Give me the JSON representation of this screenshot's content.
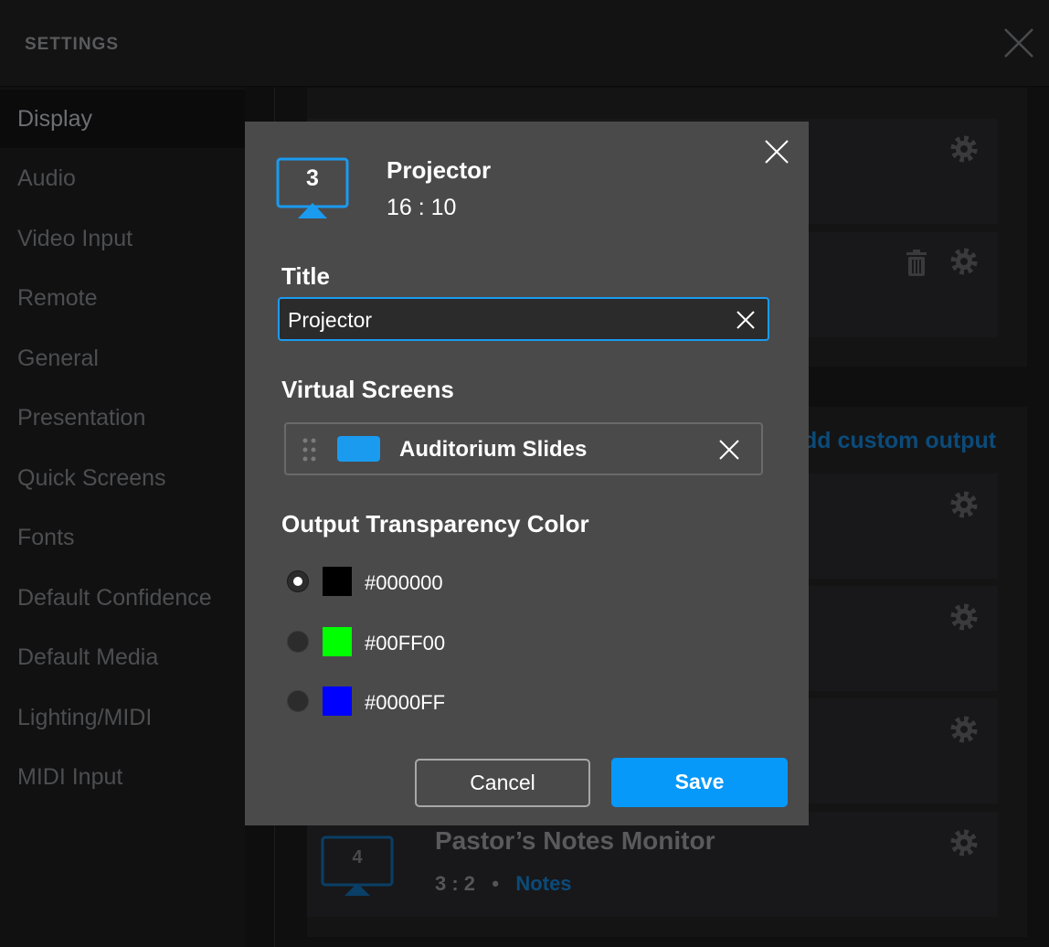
{
  "header": {
    "title": "SETTINGS"
  },
  "sidebar": {
    "items": [
      {
        "label": "Display",
        "active": true
      },
      {
        "label": "Audio"
      },
      {
        "label": "Video Input"
      },
      {
        "label": "Remote"
      },
      {
        "label": "General"
      },
      {
        "label": "Presentation"
      },
      {
        "label": "Quick Screens"
      },
      {
        "label": "Fonts"
      },
      {
        "label": "Default Confidence"
      },
      {
        "label": "Default Media"
      },
      {
        "label": "Lighting/MIDI"
      },
      {
        "label": "MIDI Input"
      }
    ]
  },
  "background": {
    "add_custom_output": "dd custom output",
    "monitor": {
      "number": "4",
      "name": "Pastor’s Notes Monitor",
      "ratio": "3 : 2",
      "separator": "•",
      "link": "Notes"
    }
  },
  "modal": {
    "screen_number": "3",
    "screen_name": "Projector",
    "aspect_ratio": "16 : 10",
    "title_label": "Title",
    "title_value": "Projector",
    "virtual_screens_label": "Virtual Screens",
    "virtual_screens": [
      {
        "name": "Auditorium Slides",
        "color": "#1a9bf0"
      }
    ],
    "transparency_label": "Output Transparency Color",
    "transparency_options": [
      {
        "hex": "#000000",
        "selected": true
      },
      {
        "hex": "#00FF00",
        "selected": false
      },
      {
        "hex": "#0000FF",
        "selected": false
      }
    ],
    "cancel_label": "Cancel",
    "save_label": "Save"
  },
  "colors": {
    "accent": "#0799f9",
    "modal_bg": "#4a4a4b"
  }
}
